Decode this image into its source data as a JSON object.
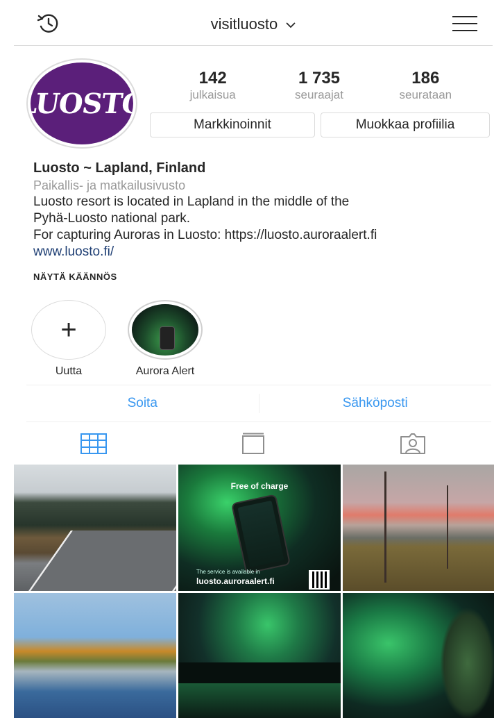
{
  "header": {
    "username": "visitluosto"
  },
  "profile": {
    "avatar_logo_text": "LUOSTO",
    "stats": [
      {
        "value": "142",
        "label": "julkaisua"
      },
      {
        "value": "1 735",
        "label": "seuraajat"
      },
      {
        "value": "186",
        "label": "seurataan"
      }
    ],
    "buttons": {
      "promotions": "Markkinoinnit",
      "edit_profile": "Muokkaa profiilia"
    }
  },
  "bio": {
    "name": "Luosto ~ Lapland, Finland",
    "category": "Paikallis- ja matkailusivusto",
    "lines": [
      "Luosto resort is located in Lapland in the middle of the",
      "Pyhä-Luosto national park.",
      "For capturing Auroras in Luosto: https://luosto.auroraalert.fi"
    ],
    "website": "www.luosto.fi/",
    "translate": "NÄYTÄ KÄÄNNÖS"
  },
  "highlights": [
    {
      "label": "Uutta"
    },
    {
      "label": "Aurora Alert"
    }
  ],
  "contact": {
    "call": "Soita",
    "email": "Sähköposti"
  },
  "colors": {
    "link_blue": "#3897f0",
    "website_link": "#1f3f74",
    "avatar_bg": "#5b1f7a",
    "muted_text": "#999999",
    "active_tab": "#3897f0"
  },
  "posts": {
    "aurora_ad": {
      "free": "Free of charge",
      "footer_line1": "The service is available in",
      "footer_line2": "luosto.auroraalert.fi"
    }
  }
}
